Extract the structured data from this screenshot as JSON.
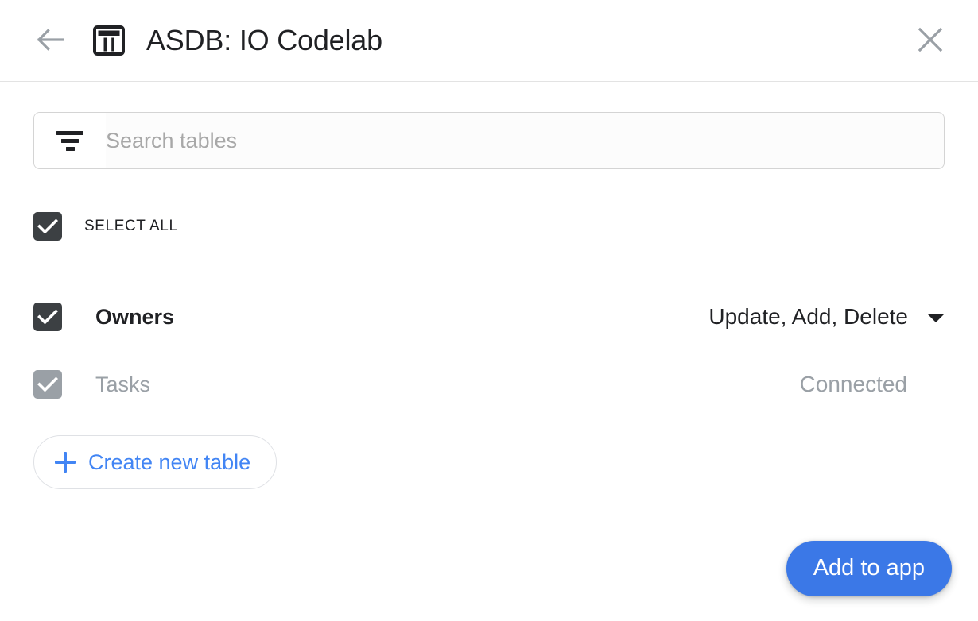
{
  "header": {
    "back_icon": "arrow-left-icon",
    "app_icon": "table-icon",
    "title": "ASDB: IO Codelab",
    "close_icon": "close-icon"
  },
  "search": {
    "filter_icon": "filter-icon",
    "placeholder": "Search tables",
    "value": ""
  },
  "select_all": {
    "label": "SELECT ALL",
    "checked": true
  },
  "tables": [
    {
      "name": "Owners",
      "checked": true,
      "enabled": true,
      "action_label": "Update, Add, Delete",
      "caret_icon": "chevron-down-icon"
    },
    {
      "name": "Tasks",
      "checked": true,
      "enabled": false,
      "status_label": "Connected"
    }
  ],
  "create_table": {
    "label": "Create new table",
    "icon": "plus-icon"
  },
  "footer": {
    "primary_label": "Add to app"
  },
  "colors": {
    "accent_blue": "#4285f4",
    "primary_button": "#3b78e7",
    "checkbox_on": "#3c4043",
    "checkbox_disabled": "#9aa0a6",
    "muted_text": "#9aa0a6",
    "divider": "#dadce0"
  }
}
